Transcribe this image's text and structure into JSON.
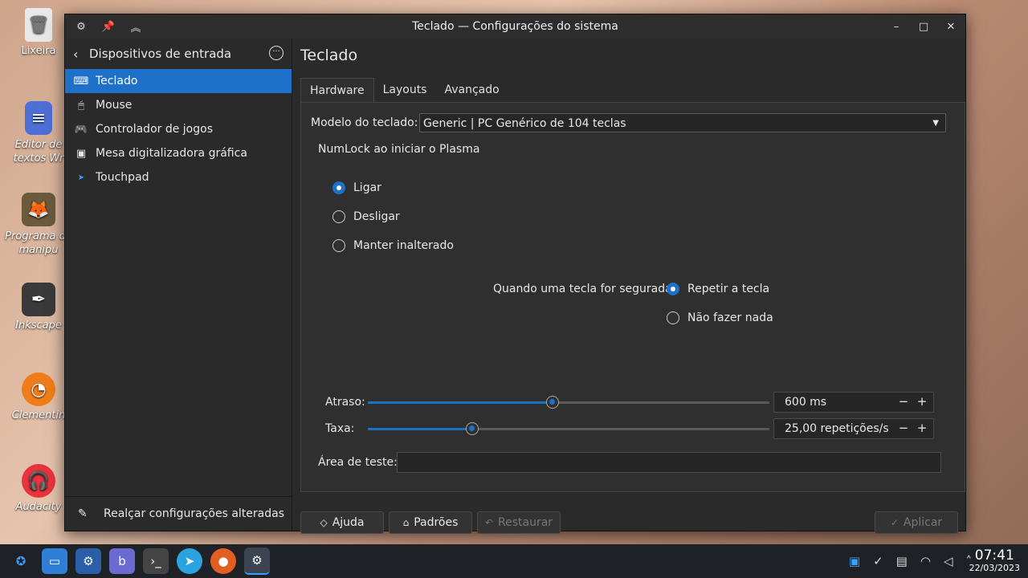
{
  "desktop": {
    "icons": [
      {
        "label": "Lixeira",
        "icon": "trash-icon"
      },
      {
        "label": "Editor de textos Wr",
        "icon": "text-editor-icon"
      },
      {
        "label": "Programa de manipu",
        "icon": "gimp-icon"
      },
      {
        "label": "Inkscape",
        "icon": "inkscape-icon"
      },
      {
        "label": "Clementin",
        "icon": "clementine-icon"
      },
      {
        "label": "Audacity",
        "icon": "audacity-icon"
      }
    ]
  },
  "window": {
    "title": "Teclado — Configurações do sistema"
  },
  "sidebar": {
    "header": "Dispositivos de entrada",
    "items": [
      {
        "label": "Teclado",
        "icon": "keyboard-icon",
        "active": true
      },
      {
        "label": "Mouse",
        "icon": "mouse-icon"
      },
      {
        "label": "Controlador de jogos",
        "icon": "gamepad-icon"
      },
      {
        "label": "Mesa digitalizadora gráfica",
        "icon": "tablet-icon"
      },
      {
        "label": "Touchpad",
        "icon": "touchpad-icon"
      }
    ],
    "footer": "Realçar configurações alteradas"
  },
  "main": {
    "title": "Teclado",
    "tabs": [
      {
        "label": "Hardware",
        "active": true
      },
      {
        "label": "Layouts"
      },
      {
        "label": "Avançado"
      }
    ],
    "model_label": "Modelo do teclado:",
    "model_value": "Generic | PC Genérico de 104 teclas",
    "numlock_label": "NumLock ao iniciar o Plasma",
    "numlock_options": [
      {
        "label": "Ligar",
        "checked": true
      },
      {
        "label": "Desligar",
        "checked": false
      },
      {
        "label": "Manter inalterado",
        "checked": false
      }
    ],
    "hold_label": "Quando uma tecla for segurada:",
    "hold_options": [
      {
        "label": "Repetir a tecla",
        "checked": true
      },
      {
        "label": "Não fazer nada",
        "checked": false
      }
    ],
    "delay_label": "Atraso:",
    "delay_value": "600 ms",
    "delay_fraction": 0.46,
    "rate_label": "Taxa:",
    "rate_value": "25,00 repetições/s",
    "rate_fraction": 0.26,
    "test_label": "Área de teste:",
    "buttons": {
      "help": "Ajuda",
      "defaults": "Padrões",
      "reset": "Restaurar",
      "apply": "Aplicar"
    }
  },
  "taskbar": {
    "time": "07:41",
    "date": "22/03/2023"
  },
  "colors": {
    "accent": "#1e70c8"
  }
}
